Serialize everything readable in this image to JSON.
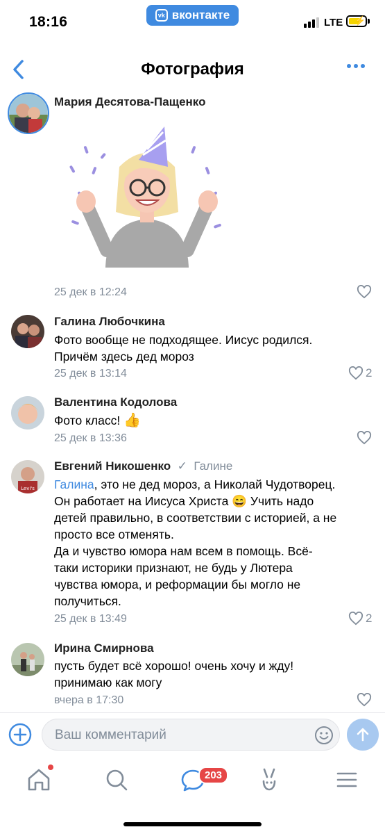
{
  "status_bar": {
    "time": "18:16",
    "app_pill": "вконтакте",
    "network": "LTE"
  },
  "nav": {
    "title": "Фотография"
  },
  "post": {
    "author": "Мария Десятова-Пащенко",
    "date": "25 дек в 12:24"
  },
  "comments": [
    {
      "author": "Галина Любочкина",
      "lines": [
        "Фото вообще не подходящее. Иисус  родился.",
        "Причём здесь дед мороз"
      ],
      "date": "25 дек в 13:14",
      "likes": "2"
    },
    {
      "author": "Валентина Кодолова",
      "text": "Фото класс!",
      "emoji": "👍",
      "date": "25 дек в 13:36",
      "likes": ""
    },
    {
      "author": "Евгений Никошенко",
      "reply_to": "Галине",
      "mention": "Галина",
      "lines": [
        ", это не дед мороз, а Николай Чудотворец.",
        "Он работает на Иисуса Христа",
        "детей правильно, в соответствии с историей, а не",
        "просто все отменять.",
        "Да и чувство юмора нам всем в помощь. Всё-",
        "таки историки признают, не будь у Лютера",
        "чувства юмора, и реформации бы могло не",
        "получиться."
      ],
      "emoji": "😄",
      "line2_tail": " Учить надо",
      "date": "25 дек в 13:49",
      "likes": "2"
    },
    {
      "author": "Ирина Смирнова",
      "lines": [
        "пусть будет всё хорошо! очень хочу и жду!",
        "принимаю как могу"
      ],
      "date": "вчера в 17:30",
      "likes": ""
    }
  ],
  "composer": {
    "placeholder": "Ваш комментарий"
  },
  "tabbar": {
    "messages_badge": "203"
  },
  "colors": {
    "accent": "#3f8ae0",
    "meta": "#818c99",
    "badge": "#e64646"
  },
  "icons": [
    "back-chevron-icon",
    "more-dots-icon",
    "heart-icon",
    "add-icon",
    "emoji-icon",
    "send-arrow-icon",
    "home-icon",
    "search-icon",
    "messages-icon",
    "clips-icon",
    "menu-icon"
  ]
}
